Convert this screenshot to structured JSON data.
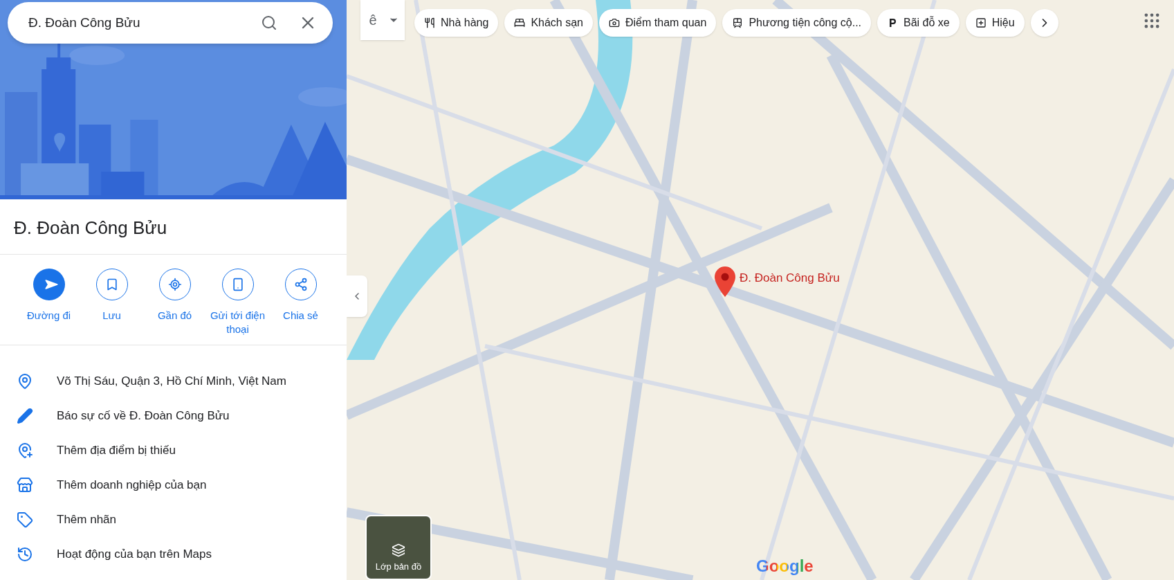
{
  "search": {
    "value": "Đ. Đoàn Công Bửu"
  },
  "place": {
    "title": "Đ. Đoàn Công Bửu"
  },
  "actions": [
    {
      "kind": "directions",
      "label": "Đường đi"
    },
    {
      "kind": "save",
      "label": "Lưu"
    },
    {
      "kind": "nearby",
      "label": "Gần đó"
    },
    {
      "kind": "phone",
      "label": "Gửi tới điện thoại"
    },
    {
      "kind": "share",
      "label": "Chia sẻ"
    }
  ],
  "info": [
    {
      "kind": "pin",
      "text": "Võ Thị Sáu, Quận 3, Hồ Chí Minh, Việt Nam"
    },
    {
      "kind": "pencil",
      "text": "Báo sự cố về Đ. Đoàn Công Bửu"
    },
    {
      "kind": "addpin",
      "text": "Thêm địa điểm bị thiếu"
    },
    {
      "kind": "store",
      "text": "Thêm doanh nghiệp của bạn"
    },
    {
      "kind": "label",
      "text": "Thêm nhãn"
    },
    {
      "kind": "history",
      "text": "Hoạt động của bạn trên Maps"
    }
  ],
  "input_tool": {
    "label": "ê"
  },
  "chips": [
    {
      "kind": "restaurant",
      "label": "Nhà hàng"
    },
    {
      "kind": "hotel",
      "label": "Khách sạn"
    },
    {
      "kind": "camera",
      "label": "Điểm tham quan"
    },
    {
      "kind": "transit",
      "label": "Phương tiện công cộ..."
    },
    {
      "kind": "parking",
      "label": "Bãi đỗ xe"
    },
    {
      "kind": "pharmacy",
      "label": "Hiệu"
    }
  ],
  "map": {
    "pin_label": "Đ. Đoàn Công Bửu",
    "layers_label": "Lớp bản đồ",
    "logo": "Google"
  }
}
